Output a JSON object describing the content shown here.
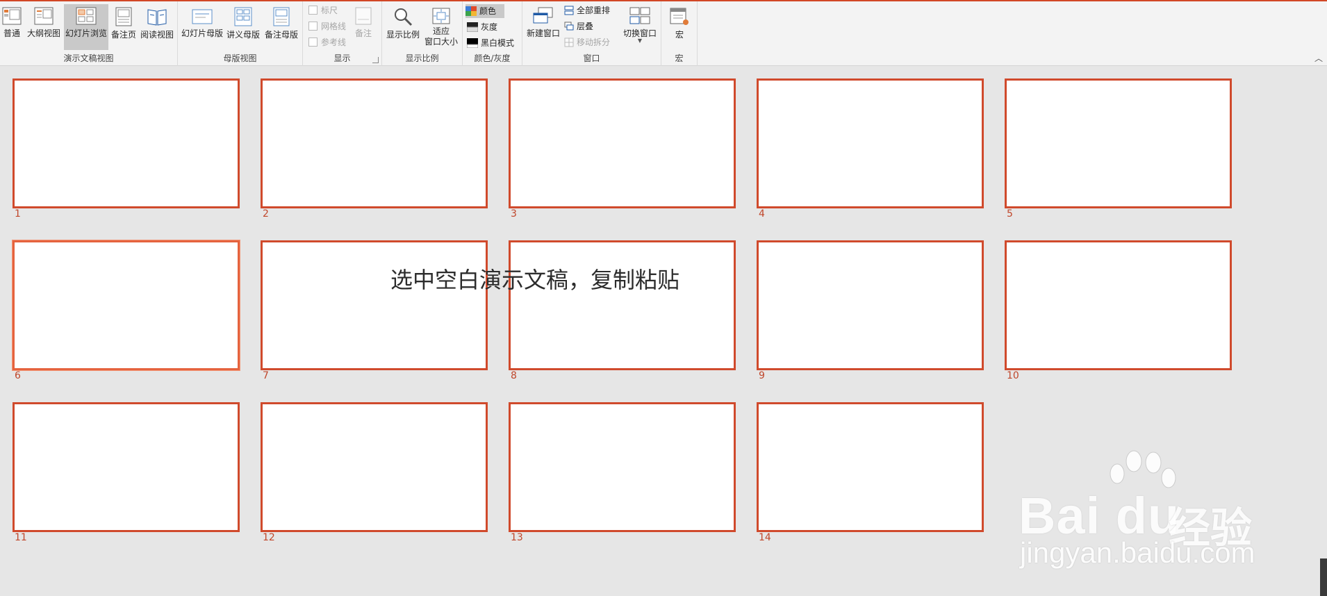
{
  "ribbon": {
    "presentation_views": {
      "group_label": "演示文稿视图",
      "normal": "普通",
      "outline": "大纲视图",
      "slide_sorter": "幻灯片浏览",
      "notes_page": "备注页",
      "reading_view": "阅读视图"
    },
    "master_views": {
      "group_label": "母版视图",
      "slide_master": "幻灯片母版",
      "handout_master": "讲义母版",
      "notes_master": "备注母版"
    },
    "show": {
      "group_label": "显示",
      "ruler": "标尺",
      "gridlines": "网格线",
      "guides": "参考线",
      "notes": "备注"
    },
    "zoom": {
      "group_label": "显示比例",
      "zoom": "显示比例",
      "fit_line1": "适应",
      "fit_line2": "窗口大小"
    },
    "color_grayscale": {
      "group_label": "颜色/灰度",
      "color": "颜色",
      "grayscale": "灰度",
      "black_white": "黑白模式"
    },
    "window": {
      "group_label": "窗口",
      "new_window": "新建窗口",
      "arrange_all": "全部重排",
      "cascade": "层叠",
      "move_split": "移动拆分",
      "switch_windows": "切换窗口"
    },
    "macros": {
      "group_label": "宏",
      "macros": "宏"
    }
  },
  "slides": [
    "1",
    "2",
    "3",
    "4",
    "5",
    "6",
    "7",
    "8",
    "9",
    "10",
    "11",
    "12",
    "13",
    "14"
  ],
  "selected_slide": "6",
  "caption": "选中空白演示文稿，复制粘贴",
  "watermark": {
    "brand": "Bai du",
    "brand_cn": "经验",
    "url": "jingyan.baidu.com"
  },
  "colors": {
    "accent": "#d04a2c",
    "ribbon_bg": "#f3f3f3",
    "workspace_bg": "#e6e6e6"
  }
}
